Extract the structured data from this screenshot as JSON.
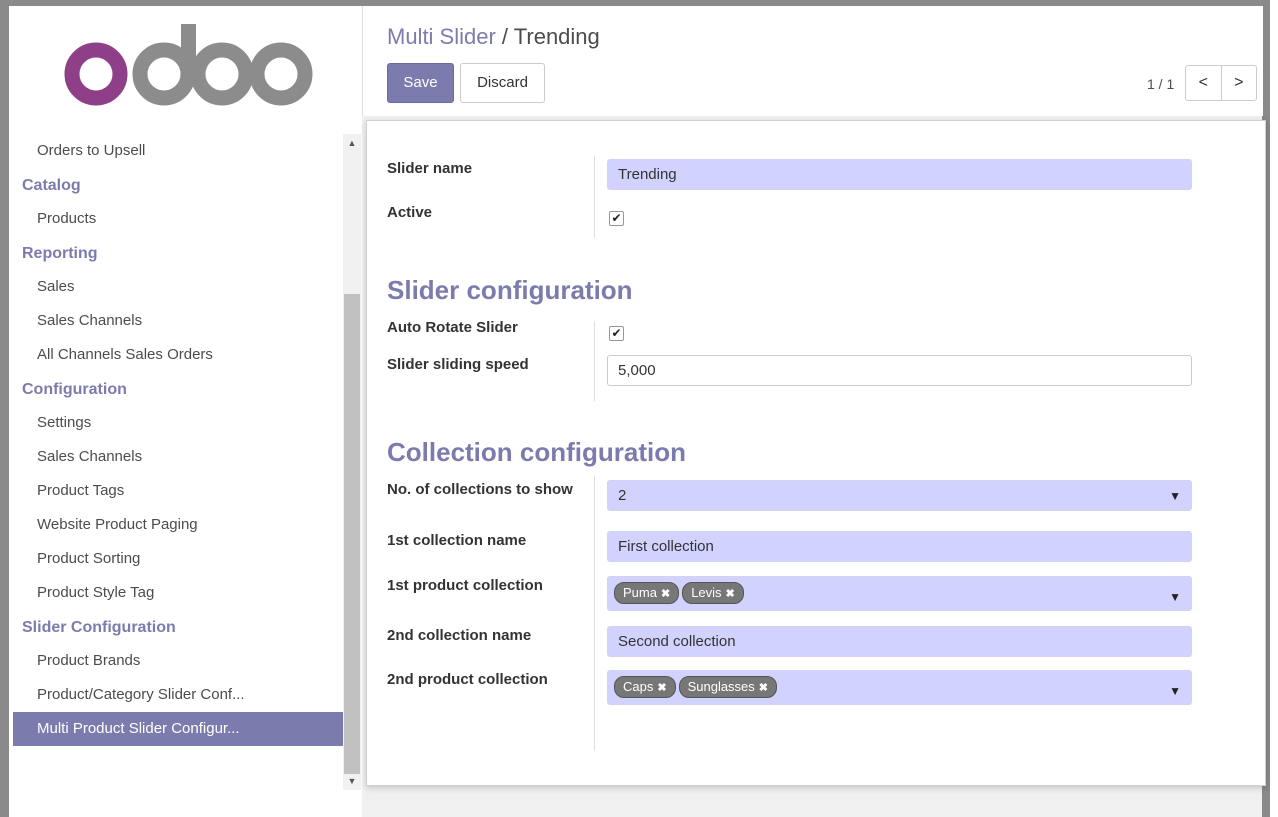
{
  "logo": {
    "text": "odoo",
    "colors": {
      "o1": "#8f3e88",
      "rest": "#8c8c8c"
    }
  },
  "sidebar": {
    "items": [
      {
        "type": "item",
        "label": "Orders to Upsell"
      },
      {
        "type": "head",
        "label": "Catalog"
      },
      {
        "type": "item",
        "label": "Products"
      },
      {
        "type": "head",
        "label": "Reporting"
      },
      {
        "type": "item",
        "label": "Sales"
      },
      {
        "type": "item",
        "label": "Sales Channels"
      },
      {
        "type": "item",
        "label": "All Channels Sales Orders"
      },
      {
        "type": "head",
        "label": "Configuration"
      },
      {
        "type": "item",
        "label": "Settings"
      },
      {
        "type": "item",
        "label": "Sales Channels"
      },
      {
        "type": "item",
        "label": "Product Tags"
      },
      {
        "type": "item",
        "label": "Website Product Paging"
      },
      {
        "type": "item",
        "label": "Product Sorting"
      },
      {
        "type": "item",
        "label": "Product Style Tag"
      },
      {
        "type": "head",
        "label": "Slider Configuration"
      },
      {
        "type": "item",
        "label": "Product Brands"
      },
      {
        "type": "item",
        "label": "Product/Category Slider Conf..."
      },
      {
        "type": "item",
        "label": "Multi Product Slider Configur...",
        "active": true
      }
    ]
  },
  "breadcrumb": {
    "parent": "Multi Slider",
    "separator": " / ",
    "current": "Trending"
  },
  "toolbar": {
    "save_label": "Save",
    "discard_label": "Discard"
  },
  "pager": {
    "value": "1 / 1",
    "prev": "<",
    "next": ">"
  },
  "form": {
    "slider_name_label": "Slider name",
    "slider_name_value": "Trending",
    "active_label": "Active",
    "active_checked": true,
    "slider_config_title": "Slider configuration",
    "auto_rotate_label": "Auto Rotate Slider",
    "auto_rotate_checked": true,
    "speed_label": "Slider sliding speed",
    "speed_value": "5,000",
    "collection_config_title": "Collection configuration",
    "num_collections_label": "No. of collections to show",
    "num_collections_value": "2",
    "first_name_label": "1st collection name",
    "first_name_value": "First collection",
    "first_product_label": "1st product collection",
    "first_product_tags": [
      "Puma",
      "Levis"
    ],
    "second_name_label": "2nd collection name",
    "second_name_value": "Second collection",
    "second_product_label": "2nd product collection",
    "second_product_tags": [
      "Caps",
      "Sunglasses"
    ]
  },
  "colors": {
    "accent": "#7c7bad",
    "required_field": "#d2d2ff"
  }
}
